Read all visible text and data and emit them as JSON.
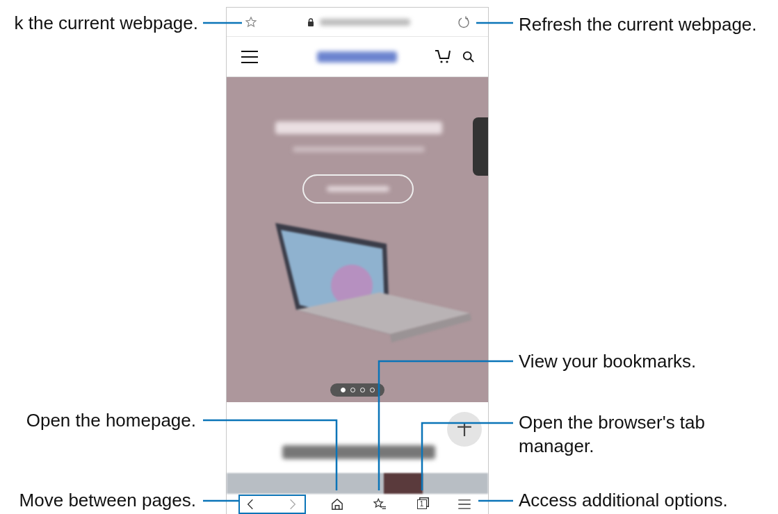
{
  "callouts": [
    {
      "text": "k the current webpage."
    },
    {
      "text": "Refresh the current webpage."
    },
    {
      "text": "View your bookmarks."
    },
    {
      "text": "Open the homepage."
    },
    {
      "text": "Open the browser's tab manager."
    },
    {
      "text": "Move between pages."
    },
    {
      "text": "Access additional options."
    }
  ],
  "carousel_dots": [
    {
      "selected": true
    },
    {
      "selected": false
    },
    {
      "selected": false
    },
    {
      "selected": false
    }
  ],
  "bottom_bar": {
    "back": {
      "disabled": false
    },
    "forward": {
      "disabled": true
    },
    "tab_count": "1"
  }
}
